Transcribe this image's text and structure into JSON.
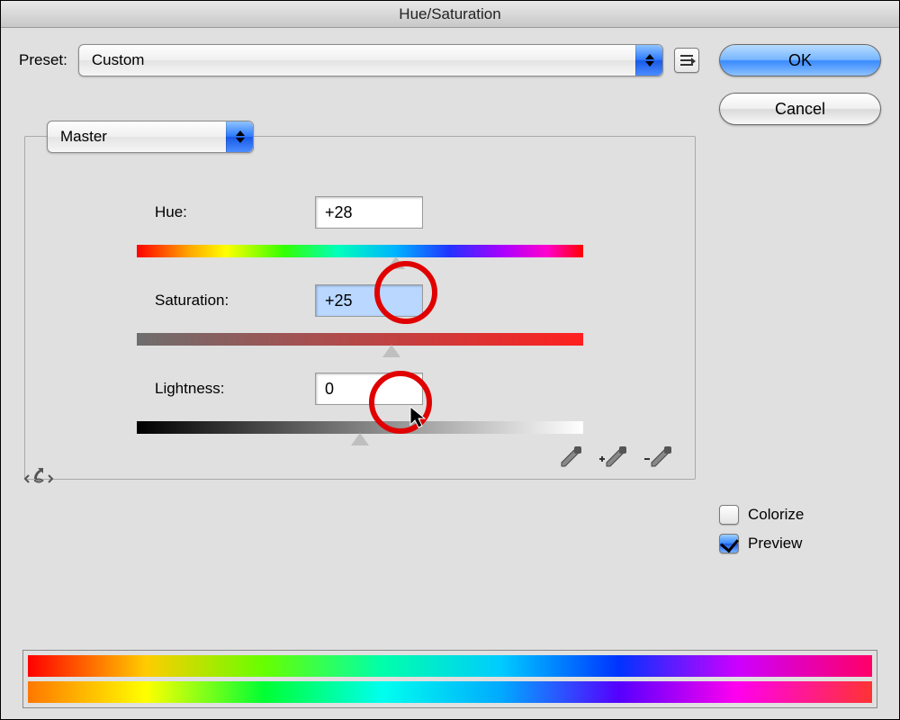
{
  "title": "Hue/Saturation",
  "preset": {
    "label": "Preset:",
    "value": "Custom"
  },
  "range_value": "Master",
  "buttons": {
    "ok": "OK",
    "cancel": "Cancel"
  },
  "sliders": {
    "hue": {
      "label": "Hue:",
      "value": "+28",
      "pos_percent": 58
    },
    "saturation": {
      "label": "Saturation:",
      "value": "+25",
      "pos_percent": 57
    },
    "lightness": {
      "label": "Lightness:",
      "value": "0",
      "pos_percent": 50
    }
  },
  "checkboxes": {
    "colorize": {
      "label": "Colorize",
      "checked": false
    },
    "preview": {
      "label": "Preview",
      "checked": true
    }
  },
  "icons": {
    "preset_menu": "preset-menu-icon",
    "scrubby": "scrubby-adjust-icon",
    "eyedropper": "eyedropper-icon",
    "eyedropper_plus": "eyedropper-add-icon",
    "eyedropper_minus": "eyedropper-subtract-icon"
  }
}
